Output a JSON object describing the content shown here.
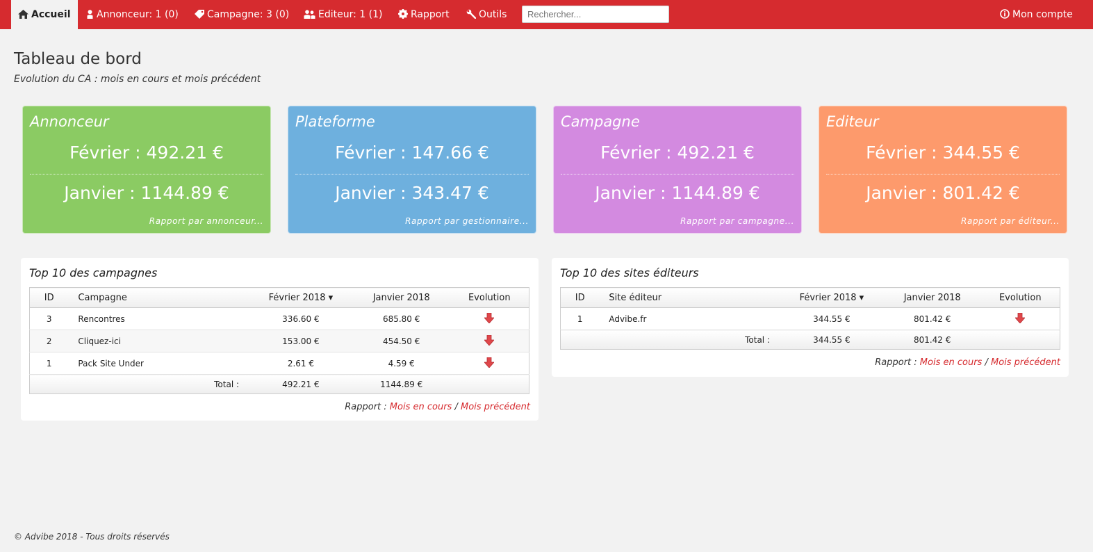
{
  "nav": {
    "home": "Accueil",
    "advertiser": "Annonceur: 1 (0)",
    "campaign": "Campagne: 3 (0)",
    "publisher": "Editeur: 1 (1)",
    "report": "Rapport",
    "tools": "Outils",
    "search_placeholder": "Rechercher...",
    "account": "Mon compte"
  },
  "header": {
    "title": "Tableau de bord",
    "subtitle": "Evolution du CA : mois en cours et mois précédent"
  },
  "cards": [
    {
      "title": "Annonceur",
      "current": "Février : 492.21 €",
      "previous": "Janvier : 1144.89 €",
      "link": "Rapport par annonceur...",
      "color": "#8bcb63"
    },
    {
      "title": "Plateforme",
      "current": "Février : 147.66 €",
      "previous": "Janvier : 343.47 €",
      "link": "Rapport par gestionnaire...",
      "color": "#6eb0de"
    },
    {
      "title": "Campagne",
      "current": "Février : 492.21 €",
      "previous": "Janvier : 1144.89 €",
      "link": "Rapport par campagne...",
      "color": "#d38ae0"
    },
    {
      "title": "Editeur",
      "current": "Février : 344.55 €",
      "previous": "Janvier : 801.42 €",
      "link": "Rapport par éditeur...",
      "color": "#fd9a6c"
    }
  ],
  "campaigns": {
    "title": "Top 10 des campagnes",
    "headers": {
      "id": "ID",
      "name": "Campagne",
      "current": "Février 2018 ▾",
      "previous": "Janvier 2018",
      "evolution": "Evolution"
    },
    "rows": [
      {
        "id": "3",
        "name": "Rencontres",
        "current": "336.60 €",
        "previous": "685.80 €"
      },
      {
        "id": "2",
        "name": "Cliquez-ici",
        "current": "153.00 €",
        "previous": "454.50 €"
      },
      {
        "id": "1",
        "name": "Pack Site Under",
        "current": "2.61 €",
        "previous": "4.59 €"
      }
    ],
    "total_label": "Total :",
    "total_current": "492.21 €",
    "total_previous": "1144.89 €"
  },
  "publishers": {
    "title": "Top 10 des sites éditeurs",
    "headers": {
      "id": "ID",
      "name": "Site éditeur",
      "current": "Février 2018 ▾",
      "previous": "Janvier 2018",
      "evolution": "Evolution"
    },
    "rows": [
      {
        "id": "1",
        "name": "Advibe.fr",
        "current": "344.55 €",
        "previous": "801.42 €"
      }
    ],
    "total_label": "Total :",
    "total_current": "344.55 €",
    "total_previous": "801.42 €"
  },
  "report_links": {
    "prefix": "Rapport :",
    "current_month": "Mois en cours",
    "separator": "/",
    "previous_month": "Mois précédent"
  },
  "footer": "© Advibe 2018 - Tous droits réservés",
  "colors": {
    "brand": "#d62b2f",
    "down_arrow": "#e0474b"
  }
}
